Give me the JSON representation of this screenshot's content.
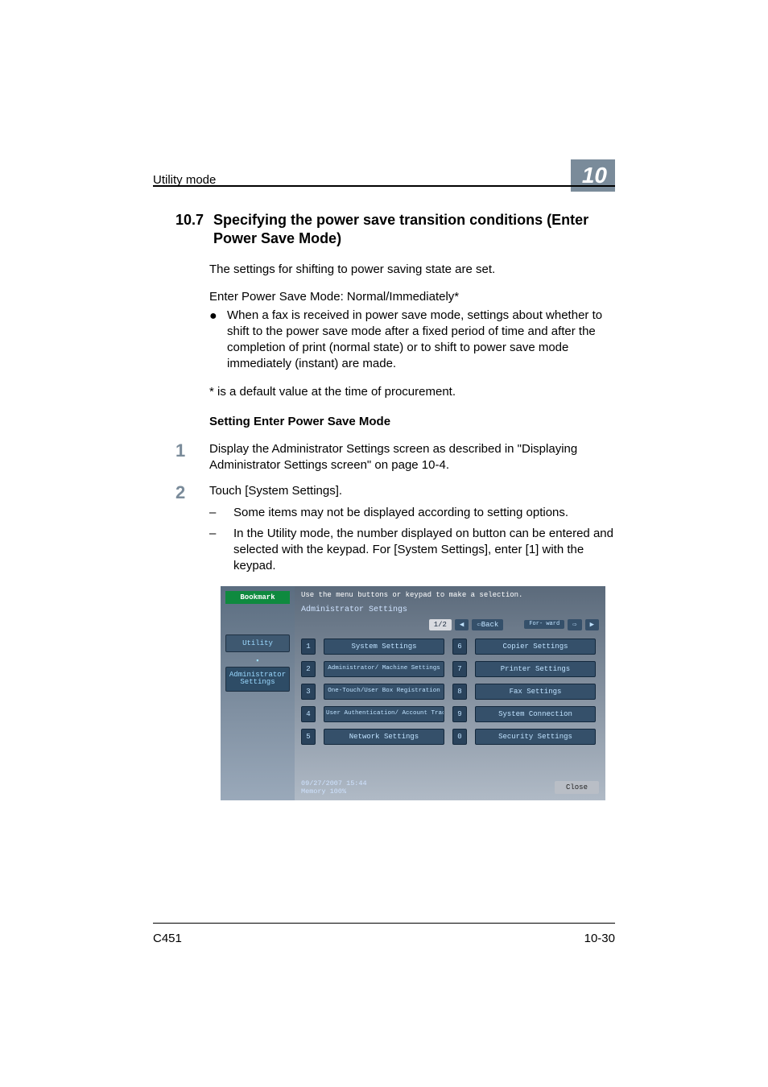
{
  "header": {
    "section_label": "Utility mode",
    "chapter_number": "10"
  },
  "section": {
    "number": "10.7",
    "title": "Specifying the power save transition conditions (Enter Power Save Mode)"
  },
  "paras": {
    "intro": "The settings for shifting to power saving state are set.",
    "mode_line": "Enter Power Save Mode: Normal/Immediately*",
    "bullet1": "When a fax is received in power save mode, settings about whether to shift to the power save mode after a fixed period of time and after the completion of print (normal state) or to shift to power save mode immediately (instant) are made.",
    "default_note": "* is a default value at the time of procurement.",
    "subheading": "Setting Enter Power Save Mode"
  },
  "steps": [
    {
      "num": "1",
      "text": "Display the Administrator Settings screen as described in \"Displaying Administrator Settings screen\" on page 10-4.",
      "dashes": []
    },
    {
      "num": "2",
      "text": "Touch [System Settings].",
      "dashes": [
        "Some items may not be displayed according to setting options.",
        "In the Utility mode, the number displayed on button can be entered and selected with the keypad. For [System Settings], enter [1] with the keypad."
      ]
    }
  ],
  "screen": {
    "top_instruction": "Use the menu buttons or keypad to make a selection.",
    "bookmark": "Bookmark",
    "left_buttons": {
      "utility": "Utility",
      "separator": "▪",
      "admin": "Administrator Settings"
    },
    "title": "Administrator Settings",
    "nav": {
      "page": "1/2",
      "arrow_left": "◀",
      "back": "⇦Back",
      "forward_label": "For- ward",
      "forward_arrow": "⇨",
      "arrow_right": "▶"
    },
    "items": [
      {
        "n": "1",
        "label": "System Settings"
      },
      {
        "n": "6",
        "label": "Copier Settings"
      },
      {
        "n": "2",
        "label": "Administrator/ Machine Settings"
      },
      {
        "n": "7",
        "label": "Printer Settings"
      },
      {
        "n": "3",
        "label": "One-Touch/User Box Registration"
      },
      {
        "n": "8",
        "label": "Fax Settings"
      },
      {
        "n": "4",
        "label": "User Authentication/ Account Track"
      },
      {
        "n": "9",
        "label": "System Connection"
      },
      {
        "n": "5",
        "label": "Network Settings"
      },
      {
        "n": "0",
        "label": "Security Settings"
      }
    ],
    "footer_left1": "09/27/2007   15:44",
    "footer_left2": "Memory        100%",
    "close": "Close"
  },
  "footer": {
    "model": "C451",
    "page": "10-30"
  }
}
